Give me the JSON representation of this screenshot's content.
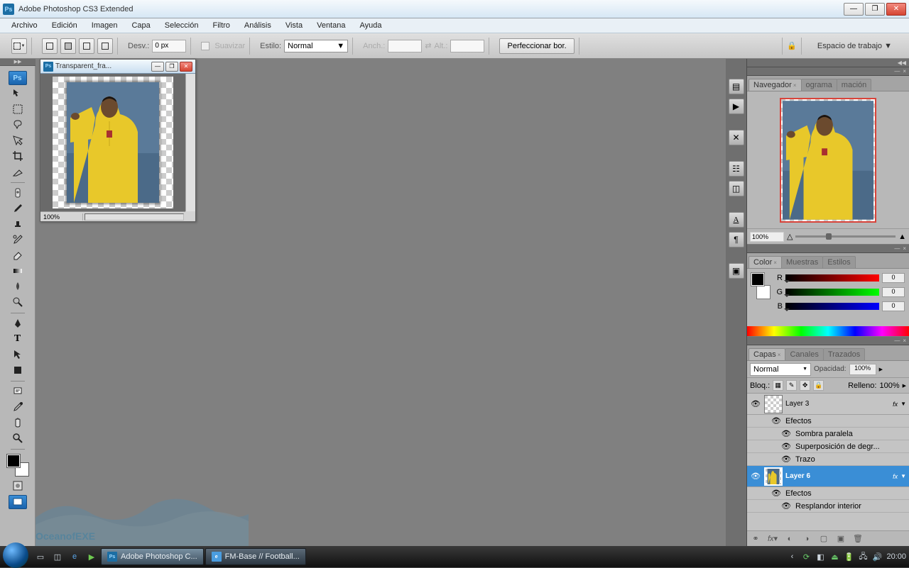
{
  "titlebar": {
    "title": "Adobe Photoshop CS3 Extended"
  },
  "menu": {
    "items": [
      "Archivo",
      "Edición",
      "Imagen",
      "Capa",
      "Selección",
      "Filtro",
      "Análisis",
      "Vista",
      "Ventana",
      "Ayuda"
    ]
  },
  "options": {
    "desv_label": "Desv.:",
    "desv_value": "0 px",
    "suavizar_label": "Suavizar",
    "estilo_label": "Estilo:",
    "estilo_value": "Normal",
    "anch_label": "Anch.:",
    "alt_label": "Alt.:",
    "perfeccionar": "Perfeccionar bor.",
    "workspace": "Espacio de trabajo"
  },
  "document": {
    "title": "Transparent_fra...",
    "zoom": "100%"
  },
  "navigator": {
    "tabs": [
      "Navegador",
      "ograma",
      "mación"
    ],
    "zoom": "100%"
  },
  "color_panel": {
    "tabs": [
      "Color",
      "Muestras",
      "Estilos"
    ],
    "channels": {
      "r_label": "R",
      "g_label": "G",
      "b_label": "B",
      "r": "0",
      "g": "0",
      "b": "0"
    }
  },
  "layers_panel": {
    "tabs": [
      "Capas",
      "Canales",
      "Trazados"
    ],
    "blend_mode": "Normal",
    "opacity_label": "Opacidad:",
    "opacity_value": "100%",
    "lock_label": "Bloq.:",
    "fill_label": "Relleno:",
    "fill_value": "100%",
    "layers": {
      "layer3": "Layer 3",
      "layer6": "Layer 6",
      "fx": "fx",
      "efectos": "Efectos",
      "sombra": "Sombra paralela",
      "degradado": "Superposición de degr...",
      "trazo": "Trazo",
      "resplandor": "Resplandor interior"
    }
  },
  "taskbar": {
    "ps_task": "Adobe Photoshop C...",
    "fm_task": "FM-Base // Football...",
    "clock": "20:00"
  },
  "watermark": "OceanofEXE"
}
